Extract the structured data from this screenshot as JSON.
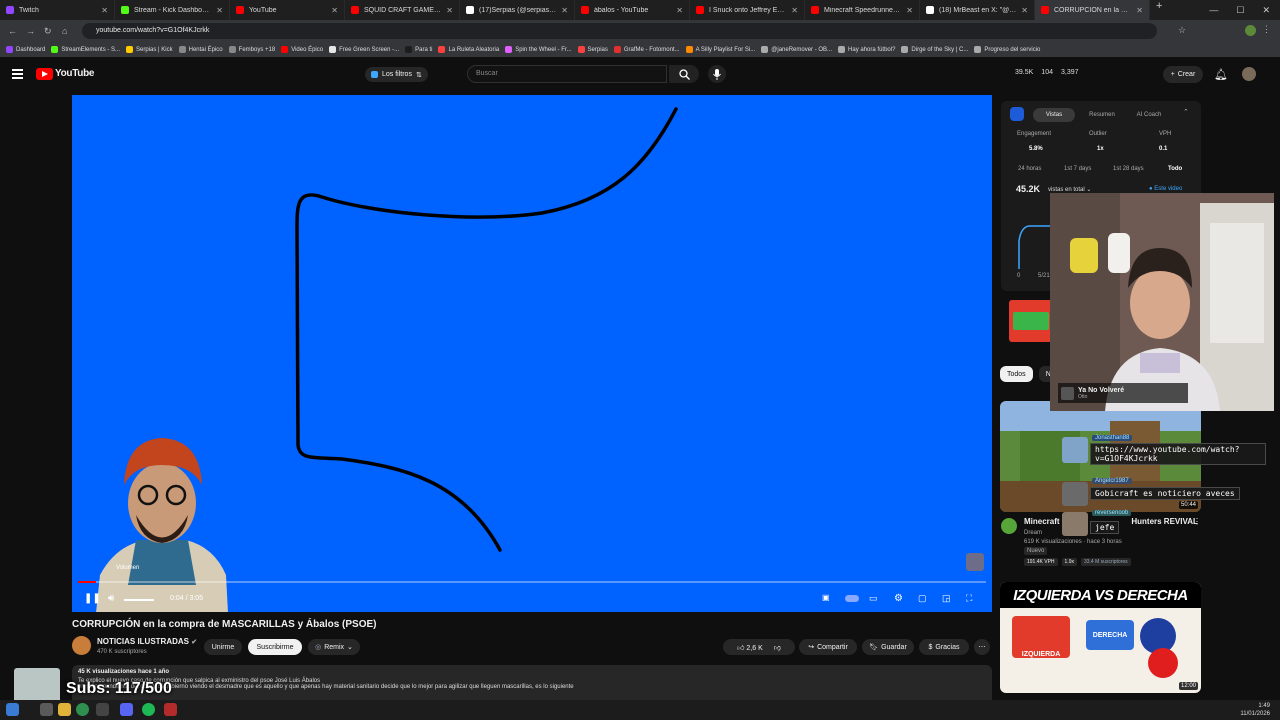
{
  "browser": {
    "tabs": [
      {
        "title": "Twitch",
        "color": "#9146ff"
      },
      {
        "title": "Stream - Kick Dashboard",
        "color": "#53fc18"
      },
      {
        "title": "YouTube",
        "color": "#ff0000"
      },
      {
        "title": "SQUID CRAFT GAMES 4: POV",
        "color": "#ff0000"
      },
      {
        "title": "(17)Serpias (@serpias) | TikTok",
        "color": "#ffffff"
      },
      {
        "title": "ábalos - YouTube",
        "color": "#ff0000"
      },
      {
        "title": "I Snuck onto Jeffrey Epstein's",
        "color": "#ff0000"
      },
      {
        "title": "Minecraft Speedrunner VS 4",
        "color": "#ff0000"
      },
      {
        "title": "(18) MrBeast en X: \"@pipkin",
        "color": "#ffffff"
      },
      {
        "title": "CORRUPCIÓN en la compra",
        "color": "#ff0000"
      }
    ],
    "url": "youtube.com/watch?v=G1Of4KJcrkk",
    "bookmarks": [
      "Dashboard",
      "StreamElements - S...",
      "Serpias | Kick",
      "Hentai Épico",
      "Femboys +18",
      "Video Épico",
      "Free Green Screen -...",
      "Para ti",
      "La Ruleta Aleatoria",
      "Spin the Wheel - Fr...",
      "Serpias",
      "GrafMe - Fotomont...",
      "A Silly Playlist For Si...",
      "@janeRemover - OB...",
      "Hay ahora fútbol?",
      "Dirge of the Sky | C...",
      "Progreso del servicio"
    ]
  },
  "youtube": {
    "logo_text": "YouTube",
    "filters_label": "Los filtros",
    "search_placeholder": "Buscar",
    "header_stats": [
      "39.5K",
      "104",
      "3,397"
    ],
    "create_label": "Crear"
  },
  "player": {
    "time": "0:04 / 3:05",
    "volume_tooltip": "Volumen",
    "progress_fraction": 0.02
  },
  "video": {
    "title": "CORRUPCIÓN en la compra de MASCARILLAS y Ábalos (PSOE)",
    "channel": "NOTICIAS ILUSTRADAS",
    "subscribers": "470 K suscriptores",
    "join_label": "Unirme",
    "subscribe_label": "Suscribirme",
    "remix_label": "Remix",
    "likes": "2,6 K",
    "share_label": "Compartir",
    "save_label": "Guardar",
    "thanks_label": "Gracias",
    "desc_meta": "45 K visualizaciones  hace 1 año",
    "desc_line1": "Te explico el nuevo caso de corrupción que salpica al exministro del psoe José Luis Ábalos",
    "desc_line2": "en plena pandemia del covid. El gobierno viendo el desmadre que es aquello y que apenas hay material sanitario decide que lo mejor para agilizar que lleguen mascarillas, es lo siguiente"
  },
  "extension": {
    "tabs": [
      "Vistas",
      "Resumen",
      "AI Coach"
    ],
    "metrics": [
      {
        "label": "Engagement",
        "value": "5.8%"
      },
      {
        "label": "Outlier",
        "value": "1x"
      },
      {
        "label": "VPH",
        "value": "0.1"
      }
    ],
    "ranges": [
      "24 horas",
      "1st 7 days",
      "1st 28 days",
      "Todo"
    ],
    "total_views": "45.2K",
    "total_label": "vistas en total",
    "this_video_label": "Este video",
    "axis_zero": "0",
    "axis_date": "5/21"
  },
  "sidebar": {
    "chips": [
      "Todos",
      "No"
    ],
    "rec1": {
      "title": "Minecraft S",
      "title_tail": "Hunters REVIVAL",
      "channel": "Dream",
      "meta": "619 K visualizaciones · hace 3 horas",
      "badge_new": "Nuevo",
      "vph": "191.4K VPH",
      "ratio": "1.9x",
      "subs": "33.4 M suscriptores",
      "duration": "50:44"
    },
    "rec2": {
      "thumb_title": "IZQUIERDA VS DERECHA",
      "label_left": "IZQUIERDA",
      "label_right": "DERECHA",
      "duration": "12:00"
    }
  },
  "stream_overlay": {
    "song_title": "Ya No Volveré",
    "song_artist": "Otto",
    "chat": [
      {
        "user": "Jonasthan88",
        "message": "https://www.youtube.com/watch?\nv=G1OF4KJcrkk"
      },
      {
        "user": "Angelcr1987",
        "message": "Gobicraft es noticiero aveces"
      },
      {
        "user": "reversenoob",
        "message": "jefe"
      }
    ],
    "subs_counter": "Subs: 117/500"
  },
  "taskbar": {
    "time": "1:49",
    "date": "11/01/2026"
  }
}
